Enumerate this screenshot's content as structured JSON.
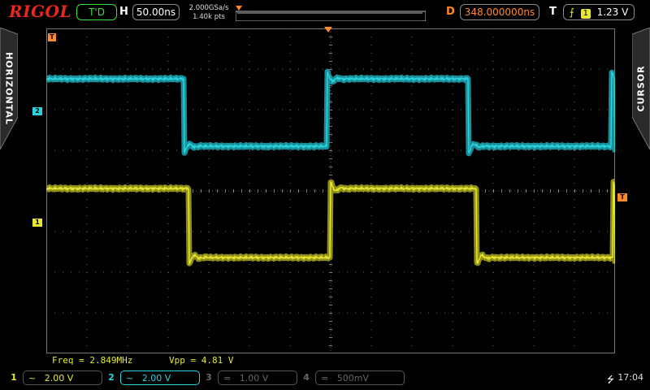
{
  "header": {
    "brand": "RIGOL",
    "run_status": "T'D",
    "h_label": "H",
    "timebase": "50.00ns",
    "sample_rate": "2.000GSa/s",
    "mem_depth": "1.40k pts",
    "d_label": "D",
    "delay": "348.000000ns",
    "t_label": "T",
    "trigger_source": "1",
    "trigger_level": "1.23 V"
  },
  "side_tabs": {
    "left": "HORIZONTAL",
    "right": "CURSOR"
  },
  "markers": {
    "trig_top": "T",
    "ch2": "2",
    "ch1": "1",
    "trig_level": "T"
  },
  "measurements": {
    "freq": "Freq = 2.849MHz",
    "vpp": "Vpp = 4.81 V"
  },
  "channels": [
    {
      "num": "1",
      "coupling": "~",
      "scale": "2.00 V",
      "enabled": true
    },
    {
      "num": "2",
      "coupling": "~",
      "scale": "2.00 V",
      "enabled": true
    },
    {
      "num": "3",
      "coupling": "=",
      "scale": "1.00 V",
      "enabled": false
    },
    {
      "num": "4",
      "coupling": "=",
      "scale": "500mV",
      "enabled": false
    }
  ],
  "status": {
    "usb": "⭍",
    "time": "17:04"
  },
  "colors": {
    "ch1": "#e8e830",
    "ch2": "#2ad4e0",
    "trigger": "#ff8a2a",
    "brand": "#e8281e"
  }
}
